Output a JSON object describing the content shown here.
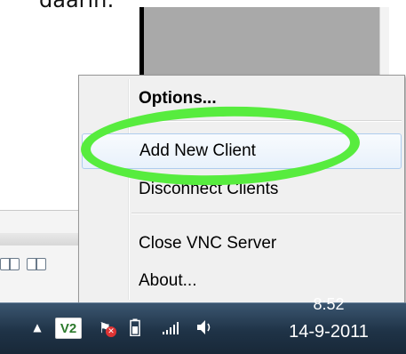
{
  "caption": "daarin:",
  "context_menu": {
    "items": [
      {
        "label": "Options...",
        "bold": true
      },
      {
        "label": "Add New Client"
      },
      {
        "label": "Disconnect Clients"
      },
      {
        "label": "Close VNC Server"
      },
      {
        "label": "About..."
      }
    ]
  },
  "taskbar": {
    "tray": {
      "overflow_icon": "up-arrow-icon",
      "vnc_icon_label": "V2",
      "action_center_icon": "flag-icon",
      "battery_icon": "battery-icon",
      "signal_icon": "signal-icon",
      "volume_icon": "speaker-icon"
    },
    "clock": {
      "time": "8:52",
      "date": "14-9-2011"
    }
  },
  "colors": {
    "highlight_ring": "#57ec3e",
    "taskbar": "#1f3347",
    "menu_background": "#f0f0f0"
  }
}
